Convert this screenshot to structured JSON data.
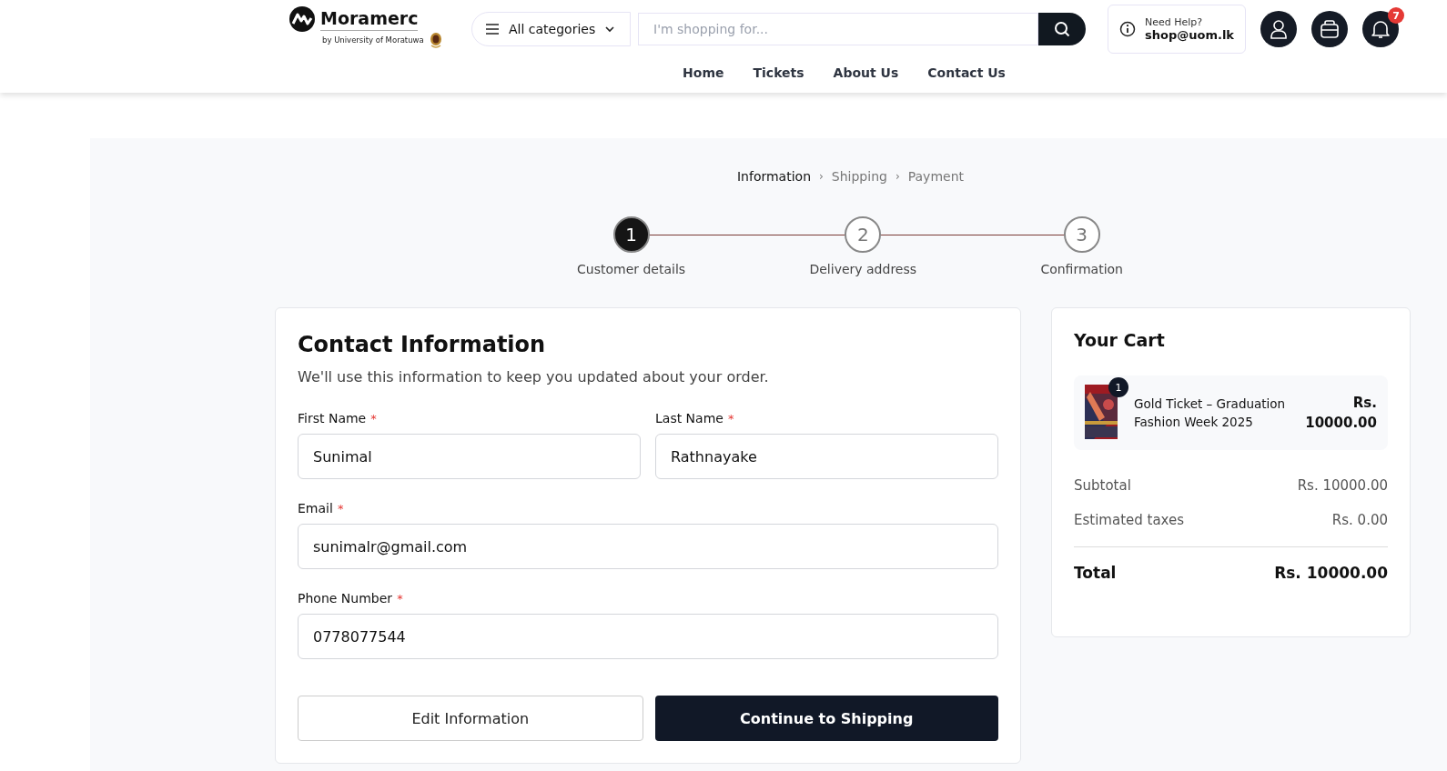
{
  "header": {
    "logo": {
      "name": "Moramerc",
      "tagline": "by University of Moratuwa"
    },
    "categories": "All categories",
    "search": {
      "placeholder": "I'm shopping for..."
    },
    "help": {
      "label": "Need Help?",
      "email": "shop@uom.lk"
    },
    "notifications": "7",
    "nav": [
      "Home",
      "Tickets",
      "About Us",
      "Contact Us"
    ]
  },
  "breadcrumb": [
    {
      "label": "Information",
      "selected": true
    },
    {
      "label": "Shipping",
      "selected": false
    },
    {
      "label": "Payment",
      "selected": false
    }
  ],
  "separator": "›",
  "steps": [
    {
      "number": "1",
      "label": "Customer details",
      "selected": true
    },
    {
      "number": "2",
      "label": "Delivery address",
      "selected": false
    },
    {
      "number": "3",
      "label": "Confirmation",
      "selected": false
    }
  ],
  "contact": {
    "required_mark": "*",
    "title": "Contact Information",
    "subtitle": "We'll use this information to keep you updated about your order.",
    "fields": [
      {
        "label": "First Name",
        "required": true,
        "value": "Sunimal"
      },
      {
        "label": "Last Name",
        "required": true,
        "value": "Rathnayake"
      },
      {
        "label": "Email",
        "required": true,
        "value": "sunimalr@gmail.com"
      },
      {
        "label": "Phone Number",
        "required": true,
        "value": "0778077544"
      }
    ],
    "buttons": [
      {
        "label": "Edit Information",
        "kind": "secondary"
      },
      {
        "label": "Continue to Shipping",
        "kind": "primary"
      }
    ]
  },
  "cart": {
    "title": "Your Cart",
    "items": [
      {
        "kind": "picture",
        "name": "Gold Ticket – Graduation Fashion Week 2025",
        "quantity": "1",
        "price": "Rs. 10000.00"
      }
    ],
    "summary": [
      {
        "label": "Subtotal",
        "value": "Rs. 10000.00"
      },
      {
        "label": "Estimated taxes",
        "value": "Rs. 0.00"
      }
    ],
    "total": {
      "label": "Total",
      "value": "Rs. 10000.00"
    }
  }
}
